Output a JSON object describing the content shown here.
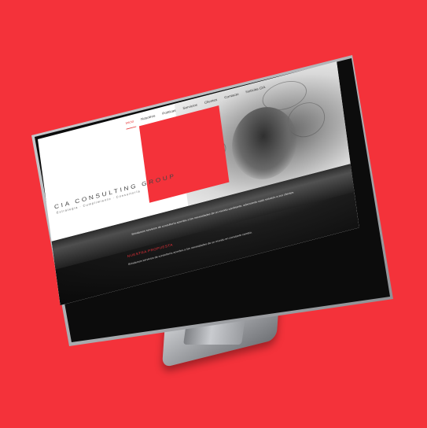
{
  "colors": {
    "background": "#f4323a",
    "accent": "#e53838",
    "screen_bg": "#ffffff"
  },
  "nav": {
    "items": [
      "Inicio",
      "Nosotros",
      "Políticas",
      "Servicios",
      "Clientes",
      "Contacto",
      "Noticias CIA"
    ]
  },
  "hero": {
    "title": "CIA CONSULTING GROUP",
    "subtitle": "Estrategia · Cumplimiento · Consultoría"
  },
  "mission": {
    "strip_text": "Brindamos servicios de consultoría acordes a las necesidades de un mundo cambiante, adecuando cada solución a sus clientes",
    "heading": "NUESTRA PROPUESTA",
    "text": "Brindamos servicios de consultoría acordes a las necesidades de un mundo en constante cambio."
  }
}
